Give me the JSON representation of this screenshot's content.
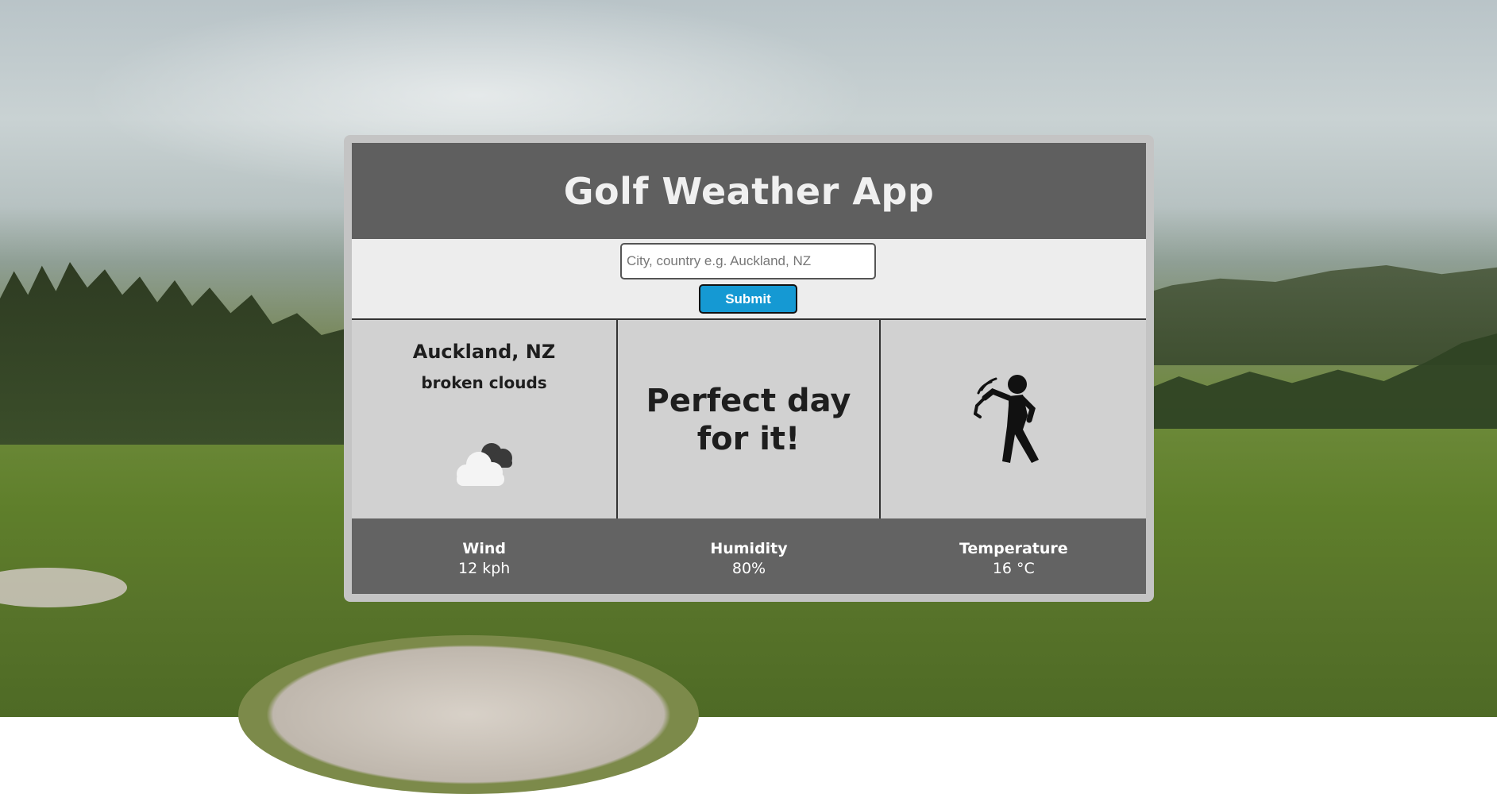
{
  "header": {
    "title": "Golf Weather App"
  },
  "search": {
    "placeholder": "City, country e.g. Auckland, NZ",
    "value": "",
    "submit_label": "Submit"
  },
  "weather": {
    "location": "Auckland, NZ",
    "description": "broken clouds",
    "condition_icon": "broken-clouds-icon",
    "message": "Perfect day for it!",
    "activity_icon": "golfer-icon"
  },
  "stats": {
    "wind": {
      "label": "Wind",
      "value": "12 kph"
    },
    "humidity": {
      "label": "Humidity",
      "value": "80%"
    },
    "temperature": {
      "label": "Temperature",
      "value": "16 °C"
    }
  },
  "colors": {
    "header_bg": "#5a5a5a",
    "submit_bg": "#1599d3",
    "frame": "#c4c4c4",
    "text_dark": "#1e1e1e",
    "text_light": "#f0f0f0"
  }
}
